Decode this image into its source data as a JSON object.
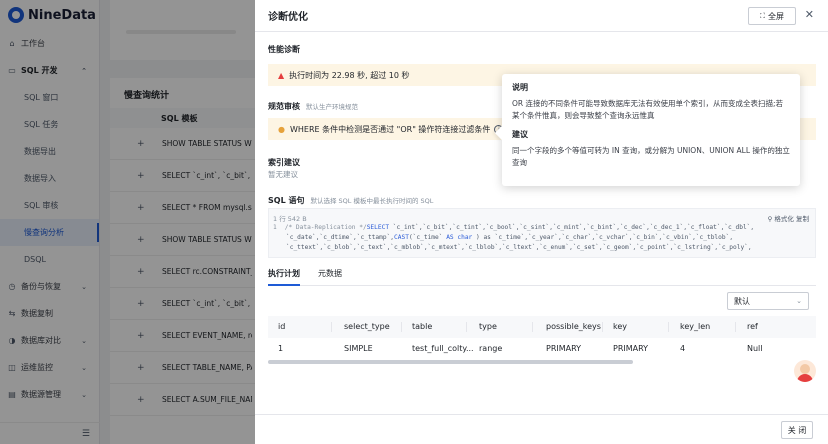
{
  "brand": {
    "name": "NineData",
    "color": "#1e5bd6"
  },
  "sidebar": {
    "items": [
      {
        "label": "工作台",
        "icon": "home-icon",
        "type": "top"
      },
      {
        "label": "SQL 开发",
        "icon": "code-icon",
        "type": "group",
        "expanded": true
      },
      {
        "label": "SQL 窗口",
        "type": "sub"
      },
      {
        "label": "SQL 任务",
        "type": "sub"
      },
      {
        "label": "数据导出",
        "type": "sub"
      },
      {
        "label": "数据导入",
        "type": "sub"
      },
      {
        "label": "SQL 审核",
        "type": "sub"
      },
      {
        "label": "慢查询分析",
        "type": "sub",
        "active": true
      },
      {
        "label": "DSQL",
        "type": "sub"
      },
      {
        "label": "备份与恢复",
        "icon": "backup-icon",
        "type": "top"
      },
      {
        "label": "数据复制",
        "icon": "replicate-icon",
        "type": "top"
      },
      {
        "label": "数据库对比",
        "icon": "compare-icon",
        "type": "top"
      },
      {
        "label": "运维监控",
        "icon": "monitor-icon",
        "type": "top"
      },
      {
        "label": "数据源管理",
        "icon": "datasource-icon",
        "type": "top"
      }
    ]
  },
  "background": {
    "panel_title": "慢查询统计",
    "column_header": "SQL 模板",
    "rows": [
      "SHOW TABLE STATUS WHERE",
      "SELECT `c_int`, `c_bit`,",
      "SELECT * FROM mysql.slow",
      "SHOW TABLE STATUS WHERE",
      "SELECT rc.CONSTRAINT_NAME",
      "SELECT `c_int`, `c_bit`,",
      "SELECT EVENT_NAME, row",
      "SELECT TABLE_NAME, PAR",
      "SELECT A.SUM_FILE_NAME"
    ]
  },
  "drawer": {
    "title": "诊断优化",
    "fullscreen_label": "全屏",
    "perf": {
      "title": "性能诊断",
      "alert": "执行时间为 22.98 秒, 超过 10 秒"
    },
    "review": {
      "title": "规范审核",
      "note": "默认生产环境规范",
      "alert": "WHERE 条件中检测是否通过 \"OR\" 操作符连接过滤条件"
    },
    "index": {
      "title": "索引建议",
      "empty": "暂无建议"
    },
    "sql": {
      "title": "SQL 语句",
      "note": "默认选择 SQL 模板中最长执行时间的 SQL",
      "meta": "1 行  542 B",
      "tools": "格式化  复制",
      "line_no": "1",
      "line1_comment": "/* Data-Replication */",
      "line1_kw": "SELECT",
      "line1_rest": " `c_int`,`c_bit`,`c_tint`,`c_bool`,`c_sint`,`c_mint`,`c_bint`,`c_dec`,`c_dec_1`,`c_float`,`c_dbl`,",
      "line2_a": "`c_date`,`c_dtime`,`c_ttamp`,",
      "line2_kw": "CAST",
      "line2_b": "(`c_time` ",
      "line2_kw2": "AS char",
      "line2_c": " ) as `c_time`,`c_year`,`c_char`,`c_vchar`,`c_bin`,`c_vbin`,`c_tblob`,",
      "line3": "`c_ttext`,`c_blob`,`c_text`,`c_mblob`,`c_mtext`,`c_lblob`,`c_ltext`,`c_enum`,`c_set`,`c_geom`,`c_point`,`c_lstring`,`c_poly`,"
    },
    "tabs": [
      "执行计划",
      "元数据"
    ],
    "select_value": "默认",
    "table": {
      "headers": [
        "id",
        "select_type",
        "table",
        "type",
        "possible_keys",
        "key",
        "key_len",
        "ref"
      ],
      "rows": [
        [
          "1",
          "SIMPLE",
          "test_full_colty...",
          "range",
          "PRIMARY",
          "PRIMARY",
          "4",
          "Null"
        ]
      ]
    },
    "close_label": "关 闭"
  },
  "tooltip": {
    "title1": "说明",
    "text1": "OR 连接的不同条件可能导致数据库无法有效使用单个索引，从而变成全表扫描;若某个条件惟真，则会导致整个查询永远惟真",
    "title2": "建议",
    "text2": "同一个字段的多个等值可转为 IN 查询，或分解为 UNION、UNION ALL 操作的独立查询"
  }
}
